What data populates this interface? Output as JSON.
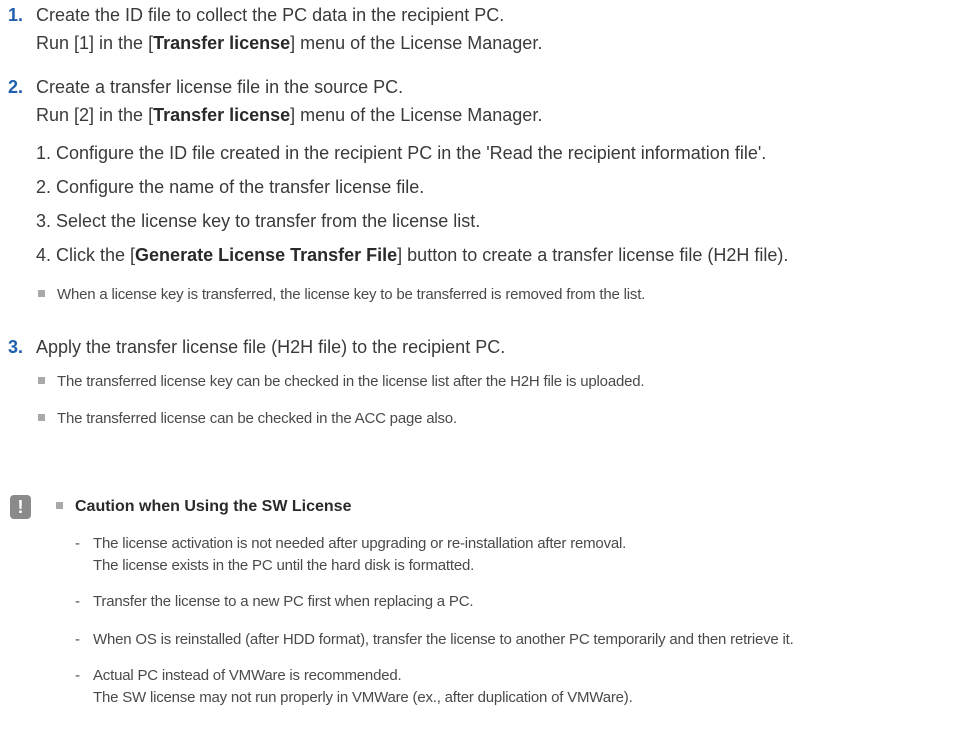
{
  "steps": [
    {
      "number": "1.",
      "title": "Create the ID file to collect the PC data in the recipient PC.",
      "run_prefix": "Run [1] in the [",
      "run_bold": "Transfer license",
      "run_suffix": "] menu of the License Manager."
    },
    {
      "number": "2.",
      "title": "Create a transfer license file in the source PC.",
      "run_prefix": "Run [2] in the [",
      "run_bold": "Transfer license",
      "run_suffix": "] menu of the License Manager.",
      "substeps": [
        "1. Configure the ID file created in the recipient PC in the 'Read the recipient information file'.",
        "2. Configure the name of the transfer license file.",
        "3. Select the license key to transfer from the license list."
      ],
      "substep4_prefix": "4. Click the [",
      "substep4_bold": "Generate License Transfer File",
      "substep4_suffix": "] button to create a transfer license file (H2H file).",
      "note": "When a license key is transferred, the license key to be transferred is removed from the list."
    },
    {
      "number": "3.",
      "title": "Apply the transfer license file (H2H file) to the recipient PC.",
      "notes": [
        "The transferred license key can be checked in the license list after the H2H file is uploaded.",
        "The transferred license can be checked in the ACC page also."
      ]
    }
  ],
  "caution": {
    "icon_glyph": "!",
    "title": "Caution when Using the SW License",
    "items": [
      [
        "The license activation is not needed after upgrading or re-installation after removal.",
        "The license exists in the PC until the hard disk is formatted."
      ],
      [
        "Transfer the license to a new PC first when replacing a PC."
      ],
      [
        "When OS is reinstalled (after HDD format), transfer the license to another PC temporarily and then retrieve it."
      ],
      [
        "Actual PC instead of VMWare is recommended.",
        "The SW license may not run properly in VMWare (ex., after duplication of VMWare)."
      ]
    ],
    "dash": "-"
  },
  "colors": {
    "step_number": "#1f5fae",
    "bullet": "#a9a9a9",
    "caution_icon_bg": "#8a8a8a"
  }
}
